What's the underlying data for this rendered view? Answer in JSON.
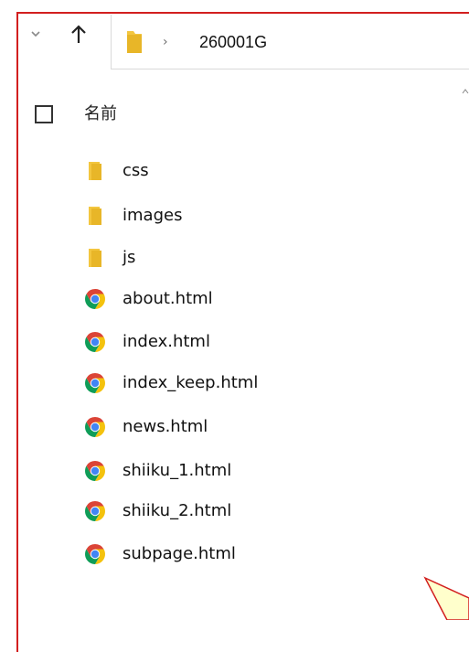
{
  "explorer": {
    "nav": {
      "back_icon": "chevron-down-icon",
      "up_icon": "arrow-up-icon"
    },
    "address": {
      "separator": "›",
      "path": "260001G"
    },
    "header": {
      "name_label": "名前"
    },
    "items": [
      {
        "label": "css",
        "type": "folder"
      },
      {
        "label": "images",
        "type": "folder"
      },
      {
        "label": "js",
        "type": "folder"
      },
      {
        "label": "about.html",
        "type": "html"
      },
      {
        "label": "index.html",
        "type": "html"
      },
      {
        "label": "index_keep.html",
        "type": "html"
      },
      {
        "label": "news.html",
        "type": "html"
      },
      {
        "label": "shiiku_1.html",
        "type": "html"
      },
      {
        "label": "shiiku_2.html",
        "type": "html"
      },
      {
        "label": "subpage.html",
        "type": "html"
      }
    ],
    "colors": {
      "frame_border": "#d21f1f",
      "folder": "#e8b628",
      "chrome_red": "#db4437",
      "chrome_yellow": "#f4c20d",
      "chrome_green": "#0f9d58",
      "chrome_blue": "#4285f4",
      "callout_fill": "#ffffcc"
    }
  }
}
